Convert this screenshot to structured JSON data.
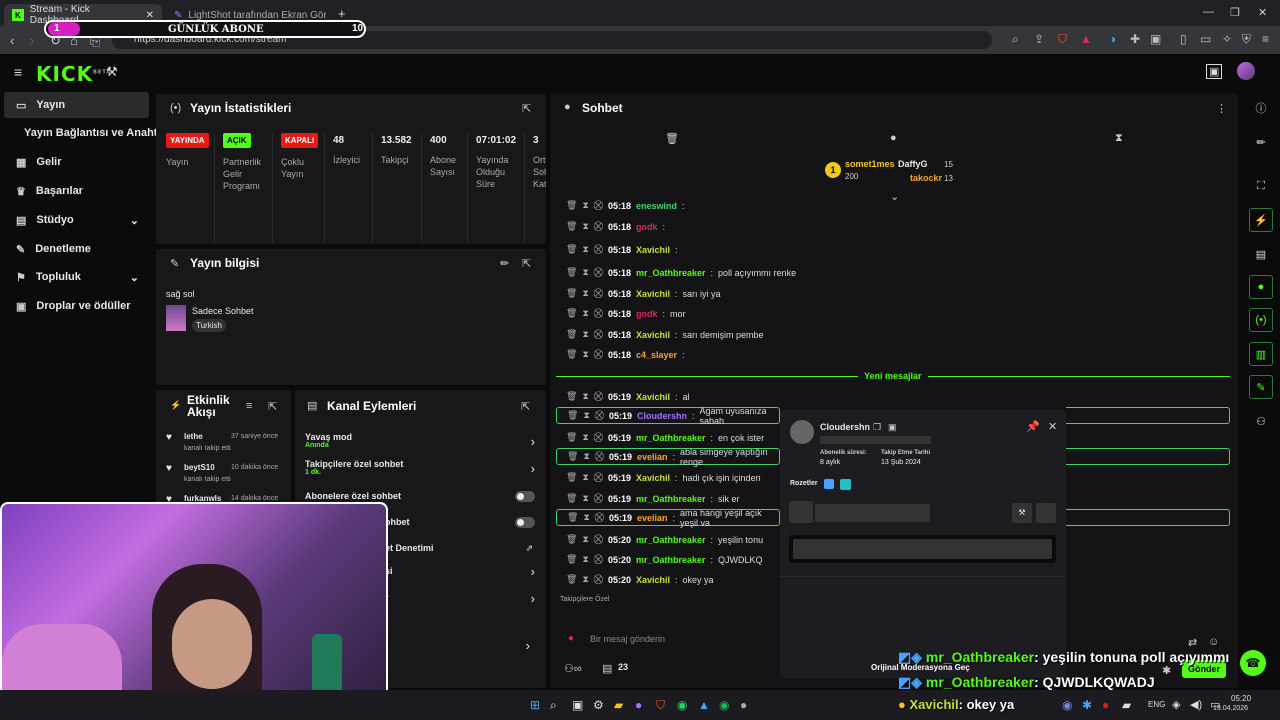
{
  "browser": {
    "tabs": [
      {
        "title": "Stream - Kick Dashboard"
      },
      {
        "title": "LightShot tarafından Ekran Görüntüsü"
      }
    ],
    "url": "https://dashboard.kick.com/stream"
  },
  "overlay": {
    "num_left": "1",
    "title": "GÜNLÜK ABONE",
    "num_right": "10"
  },
  "kick": {
    "logo": "KICK",
    "beta": "BETA"
  },
  "sidebar": {
    "items": [
      {
        "label": "Yayın"
      },
      {
        "label": "Yayın Bağlantısı ve Anahtarı"
      },
      {
        "label": "Gelir"
      },
      {
        "label": "Başarılar"
      },
      {
        "label": "Stüdyo"
      },
      {
        "label": "Denetleme"
      },
      {
        "label": "Topluluk"
      },
      {
        "label": "Droplar ve ödüller"
      }
    ]
  },
  "stats": {
    "title": "Yayın İstatistikleri",
    "items": [
      {
        "badge": "YAYINDA",
        "label": "Yayın"
      },
      {
        "badge": "AÇIK",
        "label": "Partnerlik Gelir Programı"
      },
      {
        "badge": "KAPALI",
        "label": "Çoklu Yayın"
      },
      {
        "value": "48",
        "label": "İzleyici"
      },
      {
        "value": "13.582",
        "label": "Takipçi"
      },
      {
        "value": "400",
        "label": "Abone Sayısı"
      },
      {
        "value": "07:01:02",
        "label": "Yayında Olduğu Süre"
      },
      {
        "value": "3",
        "label": "Ort. Soh. Kat."
      }
    ]
  },
  "info": {
    "title": "Yayın bilgisi",
    "stream_title": "sağ sol",
    "category": "Sadece Sohbet",
    "tag": "Turkish"
  },
  "activity": {
    "title": "Etkinlik Akışı",
    "items": [
      {
        "name": "lethe",
        "time": "37 saniye önce",
        "sub": "kanalı takip etti"
      },
      {
        "name": "beytS10",
        "time": "10 dakika önce",
        "sub": "kanalı takip etti"
      },
      {
        "name": "furkanwls",
        "time": "14 dakika önce",
        "sub": ""
      }
    ]
  },
  "actions": {
    "title": "Kanal Eylemleri",
    "items": [
      {
        "label": "Yavaş mod",
        "sub": "Anında"
      },
      {
        "label": "Takipçilere özel sohbet",
        "sub": "1 dk."
      },
      {
        "label": "Abonelere özel sohbet",
        "sub": ""
      },
      {
        "label": "ohbet",
        "sub": ""
      },
      {
        "label": "et Denetimi",
        "sub": ""
      },
      {
        "label": "si",
        "sub": ""
      },
      {
        "label": "r",
        "sub": ""
      }
    ]
  },
  "chat": {
    "title": "Sohbet",
    "leaders": [
      {
        "name": "somet1mes",
        "value": "200"
      },
      {
        "name": "DaffyG",
        "value": "15"
      },
      {
        "name": "takockr",
        "value": "13"
      }
    ],
    "new_messages": "Yeni mesajlar",
    "messages": [
      {
        "time": "05:18",
        "user": "eneswind",
        "color": "#3fd36c",
        "text": ""
      },
      {
        "time": "05:18",
        "user": "godk",
        "color": "#e0245e",
        "text": ""
      },
      {
        "time": "05:18",
        "user": "Xavichil",
        "color": "#c5e03a",
        "text": ""
      },
      {
        "time": "05:18",
        "user": "mr_Oathbreaker",
        "color": "#53fc18",
        "text": "poll açıyımmı renke"
      },
      {
        "time": "05:18",
        "user": "Xavichil",
        "color": "#c5e03a",
        "text": "sarı iyi ya"
      },
      {
        "time": "05:18",
        "user": "godk",
        "color": "#e0245e",
        "text": "mor"
      },
      {
        "time": "05:18",
        "user": "Xavichil",
        "color": "#c5e03a",
        "text": "sarı demişim pembe"
      },
      {
        "time": "05:18",
        "user": "c4_slayer",
        "color": "#f5a623",
        "text": ""
      },
      {
        "time": "05:19",
        "user": "Xavichil",
        "color": "#c5e03a",
        "text": "al"
      },
      {
        "time": "05:19",
        "user": "Cloudershn",
        "color": "#a970ff",
        "text": "Agam uyusanıza sabah"
      },
      {
        "time": "05:19",
        "user": "mr_Oathbreaker",
        "color": "#53fc18",
        "text": "en çok ister"
      },
      {
        "time": "05:19",
        "user": "evelian",
        "color": "#f5a623",
        "text": "abla simgeye yaptığın renge"
      },
      {
        "time": "05:19",
        "user": "Xavichil",
        "color": "#c5e03a",
        "text": "hadi çık işin içinden"
      },
      {
        "time": "05:19",
        "user": "mr_Oathbreaker",
        "color": "#53fc18",
        "text": "sik er"
      },
      {
        "time": "05:19",
        "user": "evelian",
        "color": "#f5a623",
        "text": "ama hangi yeşil açık yeşil va"
      },
      {
        "time": "05:20",
        "user": "mr_Oathbreaker",
        "color": "#53fc18",
        "text": "yeşilin tonu"
      },
      {
        "time": "05:20",
        "user": "mr_Oathbreaker",
        "color": "#53fc18",
        "text": "QJWDLKQ"
      },
      {
        "time": "05:20",
        "user": "Xavichil",
        "color": "#c5e03a",
        "text": "okey ya"
      }
    ],
    "followers_only": "Takipçilere Özel",
    "placeholder": "Bir mesaj gönderin",
    "viewers": "23",
    "send": "Gönder"
  },
  "popup": {
    "username": "Cloudershn",
    "sub_label": "Abonelik süresi:",
    "sub_value": "8 aylık",
    "follow_label": "Takip Etme Tarihi",
    "follow_value": "13 Şub 2024",
    "badges_label": "Rozetler"
  },
  "overlay_chat": {
    "line1_user": "mr_Oathbreaker",
    "line1_text": ": yeşilin tonuna poll açıyımmı",
    "mod_link": "Orijinal Moderasyona Geç",
    "line2_user": "mr_Oathbreaker",
    "line2_text": ": QJWDLKQWADJ",
    "line3_user": "Xavichil",
    "line3_text": ": okey ya"
  },
  "taskbar": {
    "lang": "ENG",
    "time": "05:20",
    "date": "19.04.2026"
  },
  "colors": {
    "accent": "#53fc18",
    "live": "#e91916",
    "panel": "#18181b"
  }
}
